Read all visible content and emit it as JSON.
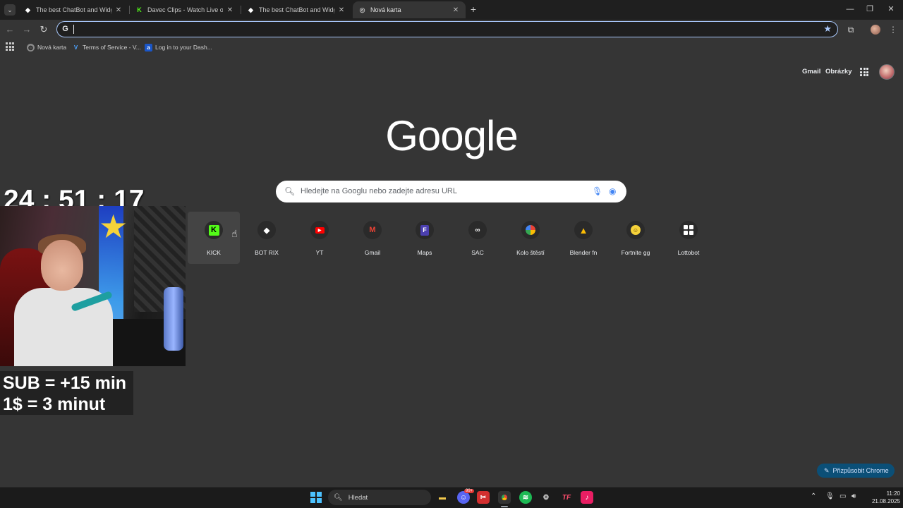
{
  "tabs": [
    {
      "title": "The best ChatBot and Widgets f",
      "favicon": "botrix-icon",
      "active": false
    },
    {
      "title": "Davec Clips - Watch Live on Kic",
      "favicon": "kick-icon",
      "active": false
    },
    {
      "title": "The best ChatBot and Widgets f",
      "favicon": "botrix-icon",
      "active": false
    },
    {
      "title": "Nová karta",
      "favicon": "chrome-icon",
      "active": true
    }
  ],
  "omnibox": {
    "value": ""
  },
  "bookmarks": [
    {
      "label": "Nová karta",
      "icon": "globe-icon"
    },
    {
      "label": "Terms of Service - V...",
      "icon": "v-icon"
    },
    {
      "label": "Log in to your Dash...",
      "icon": "a-icon"
    }
  ],
  "header": {
    "gmail": "Gmail",
    "images": "Obrázky"
  },
  "logo": "Google",
  "search": {
    "placeholder": "Hledejte na Googlu nebo zadejte adresu URL"
  },
  "shortcuts": [
    {
      "label": "KICK",
      "icon": "kick-icon",
      "color": "#53fc18"
    },
    {
      "label": "BOT RIX",
      "icon": "botrix-icon",
      "color": "#ffffff"
    },
    {
      "label": "YT",
      "icon": "youtube-icon",
      "color": "#ff0000"
    },
    {
      "label": "Gmail",
      "icon": "gmail-icon",
      "color": "#ea4335"
    },
    {
      "label": "Maps",
      "icon": "maps-icon",
      "color": "#6b5bd6"
    },
    {
      "label": "SAC",
      "icon": "link-icon",
      "color": "#ffffff"
    },
    {
      "label": "Kolo štěstí",
      "icon": "wheel-icon",
      "color": "#34a853"
    },
    {
      "label": "Blender fn",
      "icon": "drive-icon",
      "color": "#fbbc04"
    },
    {
      "label": "Fortnite gg",
      "icon": "fortnite-gg-icon",
      "color": "#f5d23a"
    },
    {
      "label": "Lottobot",
      "icon": "lottobot-icon",
      "color": "#ffffff"
    }
  ],
  "overlay": {
    "timer": "24 : 51 : 17",
    "line1": "SUB = +15 min",
    "line2": "1$ = 3 minut"
  },
  "customize": {
    "label": "Přizpůsobit Chrome"
  },
  "taskbar": {
    "search_label": "Hledat",
    "badge": "99+",
    "time": "11:20",
    "date": "21.08.2025"
  },
  "colors": {
    "accent": "#a8c7fa",
    "kick_green": "#53fc18",
    "page_bg": "#353535"
  }
}
